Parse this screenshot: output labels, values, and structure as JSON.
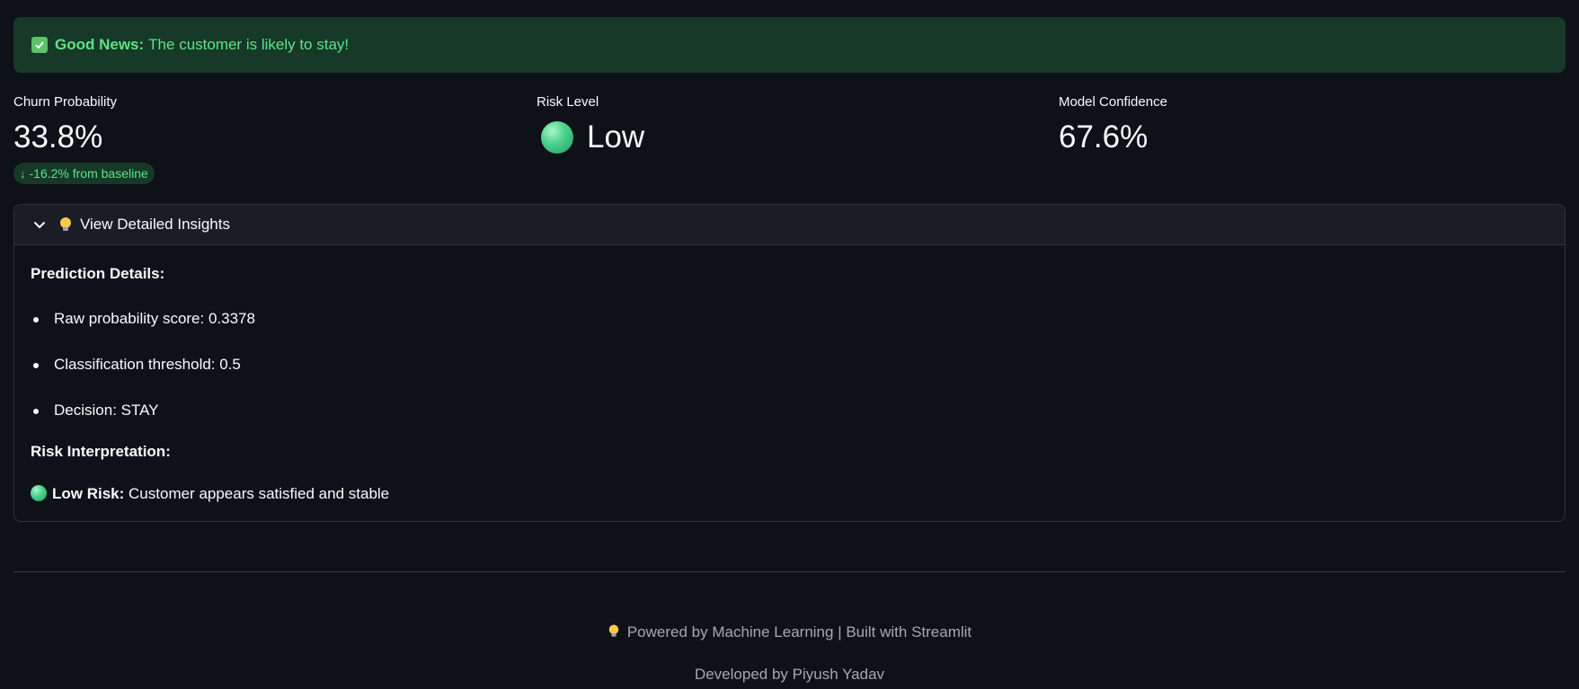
{
  "alert": {
    "strong": "Good News:",
    "message": "The customer is likely to stay!",
    "icon": "check-box-icon"
  },
  "metrics": {
    "churn": {
      "label": "Churn Probability",
      "value": "33.8%",
      "delta_arrow": "↓",
      "delta": "-16.2% from baseline"
    },
    "risk": {
      "label": "Risk Level",
      "value": "Low",
      "icon": "green-circle-icon"
    },
    "confidence": {
      "label": "Model Confidence",
      "value": "67.6%"
    }
  },
  "expander": {
    "title": "View Detailed Insights",
    "prediction_title": "Prediction Details:",
    "details": [
      "Raw probability score: 0.3378",
      "Classification threshold: 0.5",
      "Decision: STAY"
    ],
    "risk_title": "Risk Interpretation:",
    "risk_strong": "Low Risk:",
    "risk_text": "Customer appears satisfied and stable"
  },
  "footer": {
    "powered": "Powered by Machine Learning | Built with Streamlit",
    "developer": "Developed by Piyush Yadav"
  },
  "colors": {
    "background": "#0e1117",
    "success_bg": "#173928",
    "success_text": "#5ce488",
    "muted_text": "#a3a8b4"
  }
}
